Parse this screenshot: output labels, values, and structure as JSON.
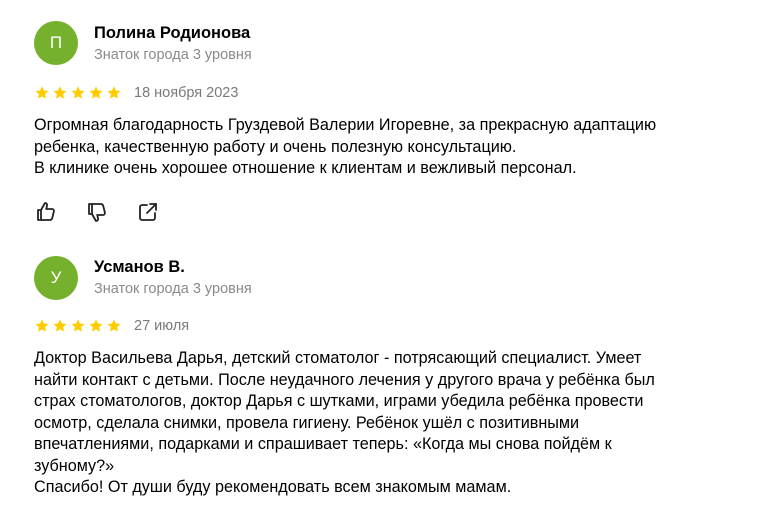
{
  "reviews": [
    {
      "avatar_letter": "П",
      "author_name": "Полина Родионова",
      "author_level": "Знаток города 3 уровня",
      "rating": 5,
      "date": "18 ноября 2023",
      "text_lines": [
        "Огромная благодарность Груздевой Валерии Игоревне, за прекрасную адаптацию",
        "ребенка, качественную работу и очень полезную консультацию.",
        "В клинике очень хорошее отношение к клиентам и вежливый персонал."
      ],
      "actions": [
        "like-icon",
        "dislike-icon",
        "share-icon"
      ]
    },
    {
      "avatar_letter": "У",
      "author_name": "Усманов В.",
      "author_level": "Знаток города 3 уровня",
      "rating": 5,
      "date": "27 июля",
      "text_lines": [
        "Доктор Васильева Дарья, детский стоматолог - потрясающий специалист. Умеет",
        "найти контакт с детьми. После неудачного лечения у другого врача у ребёнка был",
        "страх стоматологов, доктор Дарья с шутками, играми убедила ребёнка провести",
        "осмотр, сделала снимки, провела гигиену. Ребёнок ушёл с позитивными",
        "впечатлениями, подарками и спрашивает теперь: «Когда мы снова пойдём к",
        "зубному?»",
        "Спасибо! От души буду рекомендовать всем знакомым мамам."
      ]
    }
  ],
  "colors": {
    "avatar_bg": "#75b12c",
    "star": "#fc0",
    "secondary_text": "#8a8a8a"
  }
}
